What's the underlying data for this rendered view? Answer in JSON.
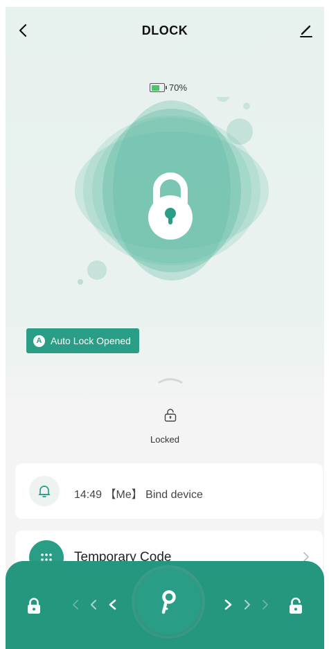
{
  "header": {
    "title": "DLOCK",
    "back_icon": "chevron-left-icon",
    "edit_icon": "pencil-icon"
  },
  "battery": {
    "text": "70%",
    "level": 0.7,
    "fill_color": "#4cc46b"
  },
  "lock": {
    "icon": "padlock-locked-icon",
    "accent_color": "#2a9d86"
  },
  "auto_lock": {
    "badge_letter": "A",
    "label": "Auto Lock Opened"
  },
  "status": {
    "icon": "padlock-small-icon",
    "text": "Locked"
  },
  "log": {
    "icon": "bell-icon",
    "text": "14:49 【Me】 Bind device"
  },
  "menu": {
    "temporary_code": {
      "icon": "dots-grid-icon",
      "label": "Temporary Code"
    }
  },
  "slider": {
    "left_icon": "lock-closed-icon",
    "right_icon": "lock-open-icon",
    "knob_icon": "key-icon",
    "bar_color": "#26977f"
  }
}
